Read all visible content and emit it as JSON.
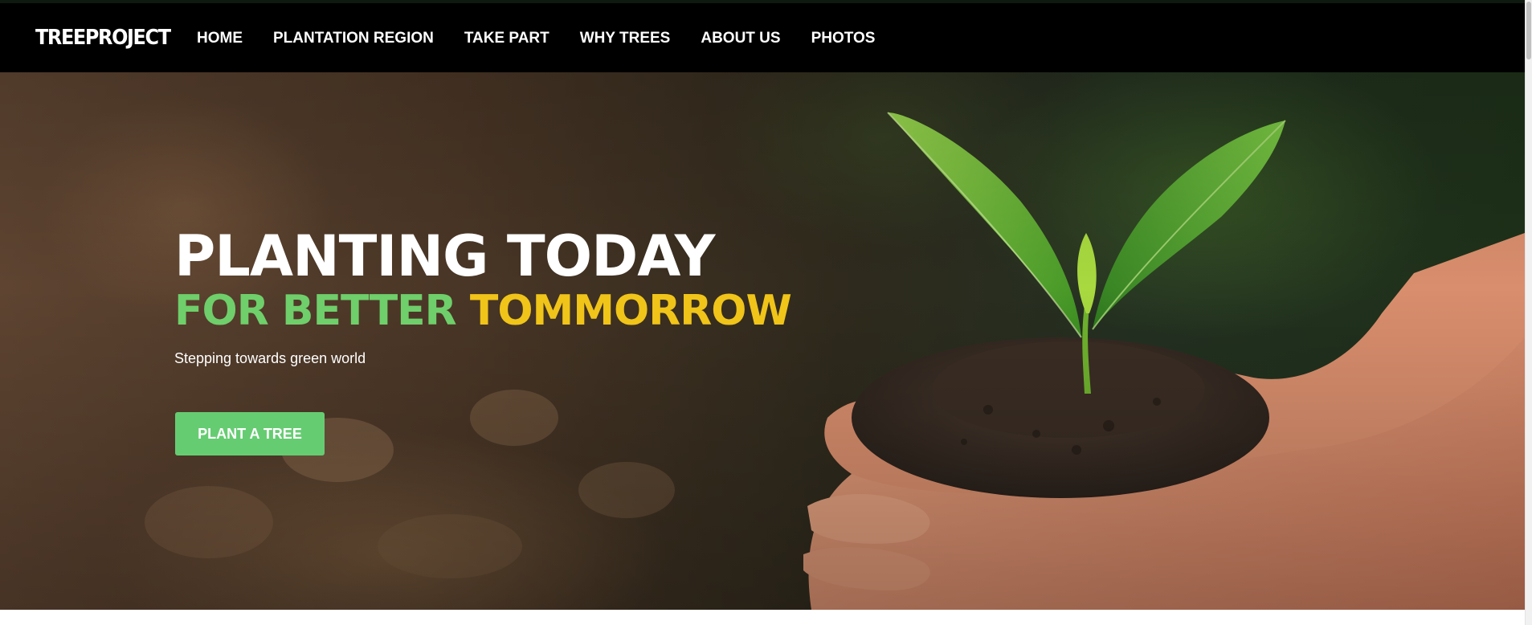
{
  "nav": {
    "logo": "TREEPROJECT",
    "links": [
      "HOME",
      "PLANTATION REGION",
      "TAKE PART",
      "WHY TREES",
      "ABOUT US",
      "PHOTOS"
    ]
  },
  "hero": {
    "headline_line1": "PLANTING TODAY",
    "headline_line2_green": "FOR BETTER",
    "headline_line2_yellow": "TOMMORROW",
    "subtitle": "Stepping towards green world",
    "cta_label": "PLANT A TREE",
    "image": "hands-holding-seedling-in-soil"
  },
  "colors": {
    "nav_bg": "#000000",
    "accent_green": "#6fcf6a",
    "accent_yellow": "#f0c419",
    "cta_bg": "#66cc72"
  }
}
